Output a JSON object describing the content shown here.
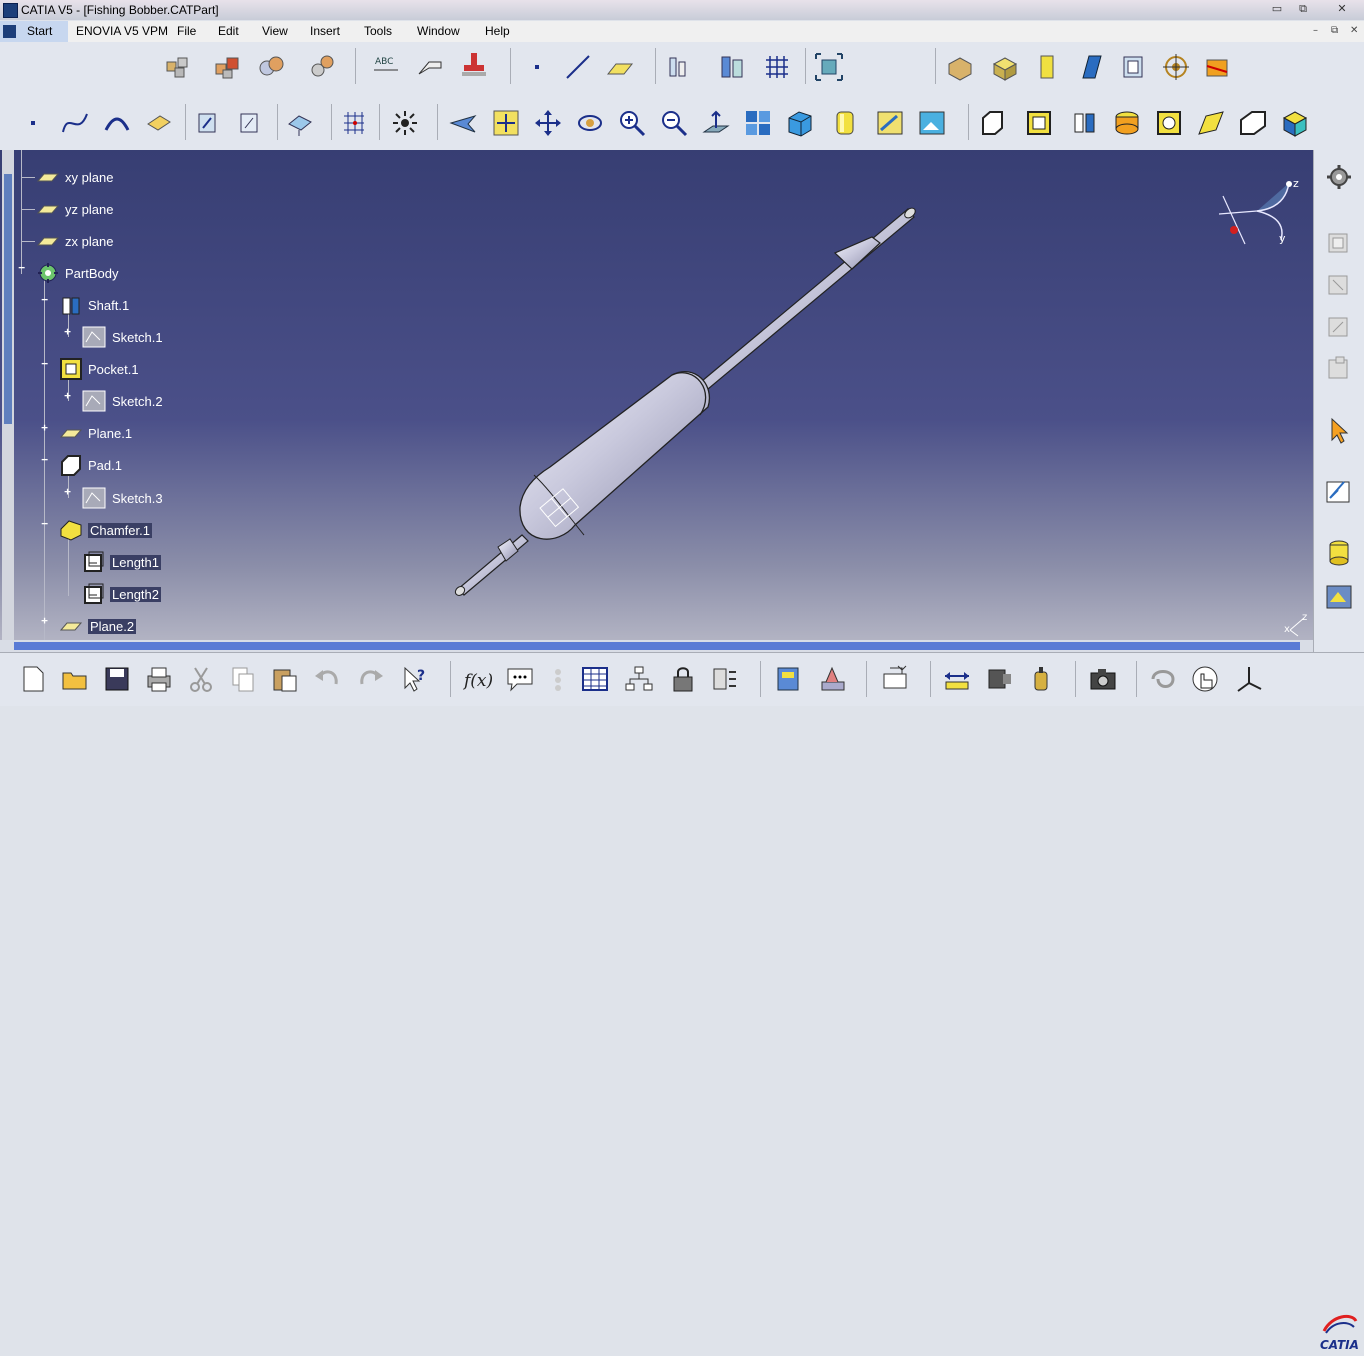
{
  "window": {
    "title": "CATIA V5 - [Fishing Bobber.CATPart]",
    "minimize": "▭",
    "maximize": "⧉",
    "close": "✕"
  },
  "menu": {
    "start": "Start",
    "items": [
      "ENOVIA V5 VPM",
      "File",
      "Edit",
      "View",
      "Insert",
      "Tools",
      "Window",
      "Help"
    ]
  },
  "mdi_controls": [
    "–",
    "⧉",
    "✕"
  ],
  "spec_tree": {
    "nodes": [
      {
        "label": "xy plane",
        "icon": "plane-icon"
      },
      {
        "label": "yz plane",
        "icon": "plane-icon"
      },
      {
        "label": "zx plane",
        "icon": "plane-icon"
      },
      {
        "label": "PartBody",
        "icon": "partbody-gear-icon"
      },
      {
        "label": "Shaft.1",
        "icon": "shaft-icon"
      },
      {
        "label": "Sketch.1",
        "icon": "sketch-icon"
      },
      {
        "label": "Pocket.1",
        "icon": "pocket-icon"
      },
      {
        "label": "Sketch.2",
        "icon": "sketch-icon"
      },
      {
        "label": "Plane.1",
        "icon": "plane-icon"
      },
      {
        "label": "Pad.1",
        "icon": "pad-icon"
      },
      {
        "label": "Sketch.3",
        "icon": "sketch-icon"
      },
      {
        "label": "Chamfer.1",
        "icon": "chamfer-icon"
      },
      {
        "label": "Length1",
        "icon": "parameter-icon"
      },
      {
        "label": "Length2",
        "icon": "parameter-icon"
      },
      {
        "label": "Plane.2",
        "icon": "plane-icon"
      }
    ]
  },
  "compass": {
    "z": "z",
    "y": "y"
  },
  "mini_axis": {
    "z": "z",
    "x": "x"
  },
  "brand": {
    "logo_text": "CATIA"
  },
  "colors": {
    "viewport_top": "#373e73",
    "viewport_bottom": "#b2b3c3",
    "selection_highlight": "#3a3f64",
    "scrollbar_thumb": "#5a7bd5"
  }
}
